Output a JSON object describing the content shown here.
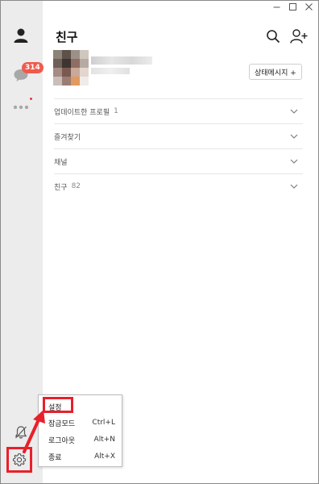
{
  "window": {
    "controls": [
      "minimize-icon",
      "maximize-icon",
      "close-icon"
    ]
  },
  "sidebar": {
    "chat_badge": "314"
  },
  "header": {
    "title": "친구"
  },
  "profile": {
    "status_button_label": "상태메시지 +"
  },
  "sections": [
    {
      "label": "업데이트한 프로필",
      "count": "1"
    },
    {
      "label": "즐겨찾기",
      "count": ""
    },
    {
      "label": "채널",
      "count": ""
    },
    {
      "label": "친구",
      "count": "82"
    }
  ],
  "menu": {
    "items": [
      {
        "label": "설정",
        "shortcut": ""
      },
      {
        "label": "잠금모드",
        "shortcut": "Ctrl+L"
      },
      {
        "label": "로그아웃",
        "shortcut": "Alt+N"
      },
      {
        "label": "종료",
        "shortcut": "Alt+X"
      }
    ]
  },
  "colors": {
    "accent_red": "#e8202a",
    "badge_red": "#ef5a4c",
    "sidebar_bg": "#ececec"
  }
}
